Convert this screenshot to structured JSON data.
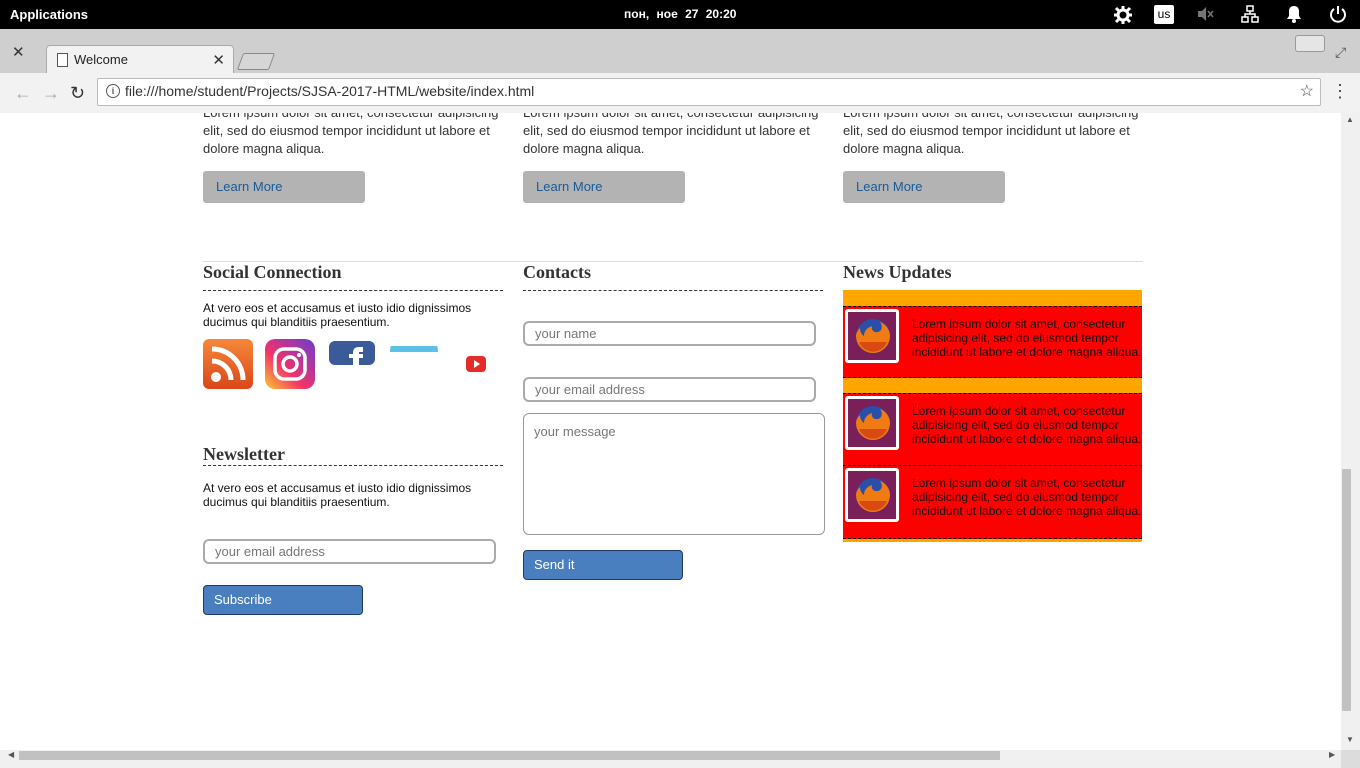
{
  "os": {
    "applications": "Applications",
    "clock": "пон, ное 27   20:20",
    "keyboard_layout": "us"
  },
  "browser": {
    "tab_title": "Welcome",
    "url": "file:///home/student/Projects/SJSA-2017-HTML/website/index.html"
  },
  "features": [
    {
      "text": "Lorem ipsum dolor sit amet, consectetur adipisicing elit, sed do eiusmod tempor incididunt ut labore et dolore magna aliqua.",
      "button": "Learn More"
    },
    {
      "text": "Lorem ipsum dolor sit amet, consectetur adipisicing elit, sed do eiusmod tempor incididunt ut labore et dolore magna aliqua.",
      "button": "Learn More"
    },
    {
      "text": "Lorem ipsum dolor sit amet, consectetur adipisicing elit, sed do eiusmod tempor incididunt ut labore et dolore magna aliqua.",
      "button": "Learn More"
    }
  ],
  "social": {
    "heading": "Social Connection",
    "text": "At vero eos et accusamus et iusto idio dignissimos ducimus qui blanditiis praesentium.",
    "icons": [
      "rss-icon",
      "instagram-icon",
      "facebook-icon",
      "twitter-icon",
      "youtube-icon"
    ]
  },
  "newsletter": {
    "heading": "Newsletter",
    "text": "At vero eos et accusamus et iusto idio dignissimos ducimus qui blanditiis praesentium.",
    "email_placeholder": "your email address",
    "button": "Subscribe"
  },
  "contacts": {
    "heading": "Contacts",
    "name_placeholder": "your name",
    "email_placeholder": "your email address",
    "message_placeholder": "your message",
    "button": "Send it"
  },
  "news": {
    "heading": "News Updates",
    "items": [
      {
        "text": "Lorem ipsum dolor sit amet, consectetur adipisicing elit, sed do eiusmod tempor incididunt ut labore et dolore magna aliqua."
      },
      {
        "text": "Lorem ipsum dolor sit amet, consectetur adipisicing elit, sed do eiusmod tempor incididunt ut labore et dolore magna aliqua."
      },
      {
        "text": "Lorem ipsum dolor sit amet, consectetur adipisicing elit, sed do eiusmod tempor incididunt ut labore et dolore magna aliqua."
      }
    ]
  },
  "colors": {
    "news_bg": "#ffa500",
    "news_item": "#ff0000",
    "blue_button": "#4a7fbf",
    "learn_button": "#b3b3b3"
  }
}
